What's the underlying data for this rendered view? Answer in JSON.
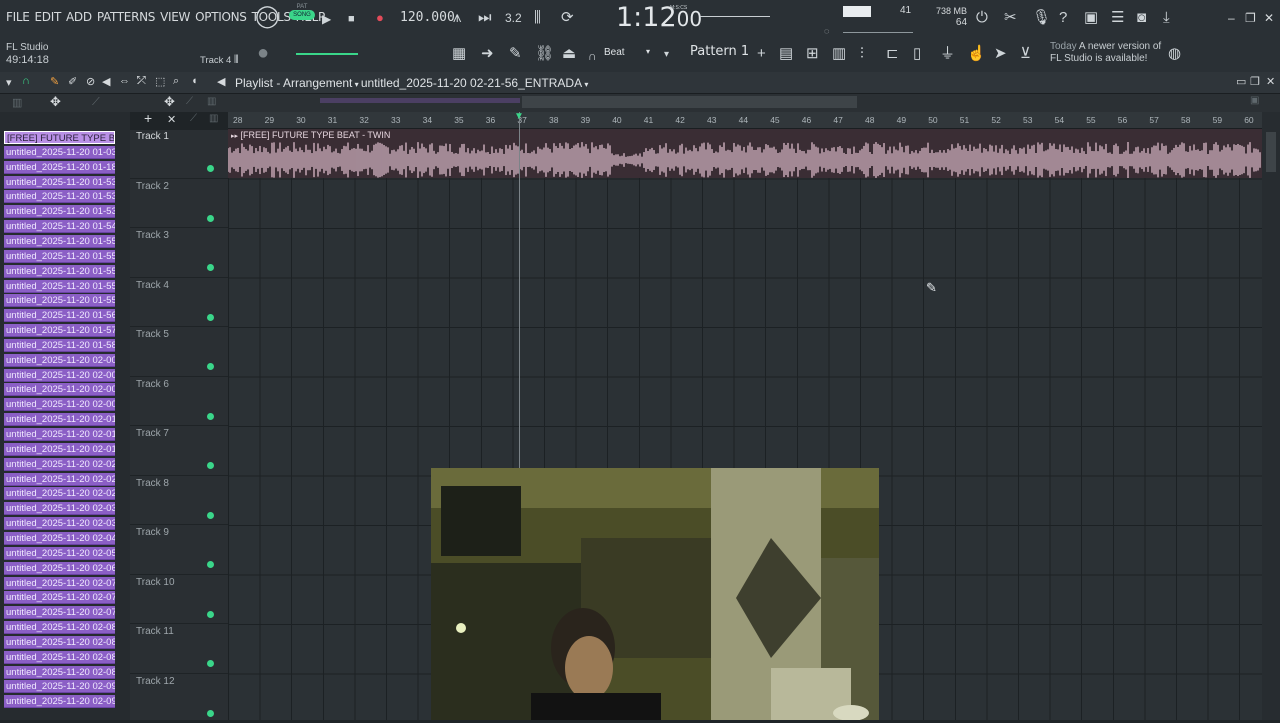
{
  "menu": [
    "FILE",
    "EDIT",
    "ADD",
    "PATTERNS",
    "VIEW",
    "OPTIONS",
    "TOOLS",
    "HELP"
  ],
  "transport": {
    "pat_label": "PAT",
    "song_label": "SONG",
    "tempo": "120.000",
    "time_main": "1:12",
    "time_sub": "00",
    "time_unit": "M:S:CS",
    "cpu": "41",
    "ram": "738 MB",
    "poly": "64"
  },
  "app": {
    "name": "FL Studio",
    "elapsed": "49:14:18",
    "track_hint": "Track 4"
  },
  "toolbar": {
    "snap": "Beat",
    "pattern": "Pattern 1",
    "pattern_add": "+"
  },
  "news": {
    "when": "Today",
    "line1": "A newer version of",
    "line2": "FL Studio is available!"
  },
  "playlist": {
    "title": "Playlist - Arrangement",
    "project": "untitled_2025-11-20 02-21-56_ENTRADA"
  },
  "ruler_labels": [
    "28",
    "29",
    "30",
    "31",
    "32",
    "33",
    "34",
    "35",
    "36",
    "37",
    "38",
    "39",
    "40",
    "41",
    "42",
    "43",
    "44",
    "45",
    "46",
    "47",
    "48",
    "49",
    "50",
    "51",
    "52",
    "53",
    "54",
    "55",
    "56",
    "57",
    "58",
    "59",
    "60"
  ],
  "clip": {
    "label": "[FREE] FUTURE TYPE BEAT - TWIN"
  },
  "tracks": [
    "Track 1",
    "Track 2",
    "Track 3",
    "Track 4",
    "Track 5",
    "Track 6",
    "Track 7",
    "Track 8",
    "Track 9",
    "Track 10",
    "Track 11",
    "Track 12"
  ],
  "patterns": [
    "[FREE] FUTURE TYPE BE...",
    "untitled_2025-11-20 01-03...",
    "untitled_2025-11-20 01-18...",
    "untitled_2025-11-20 01-53...",
    "untitled_2025-11-20 01-53...",
    "untitled_2025-11-20 01-53...",
    "untitled_2025-11-20 01-54...",
    "untitled_2025-11-20 01-55...",
    "untitled_2025-11-20 01-55...",
    "untitled_2025-11-20 01-55...",
    "untitled_2025-11-20 01-55...",
    "untitled_2025-11-20 01-55...",
    "untitled_2025-11-20 01-56...",
    "untitled_2025-11-20 01-57...",
    "untitled_2025-11-20 01-58...",
    "untitled_2025-11-20 02-00...",
    "untitled_2025-11-20 02-00...",
    "untitled_2025-11-20 02-00...",
    "untitled_2025-11-20 02-00...",
    "untitled_2025-11-20 02-01...",
    "untitled_2025-11-20 02-01...",
    "untitled_2025-11-20 02-01...",
    "untitled_2025-11-20 02-02...",
    "untitled_2025-11-20 02-02...",
    "untitled_2025-11-20 02-02...",
    "untitled_2025-11-20 02-03...",
    "untitled_2025-11-20 02-03...",
    "untitled_2025-11-20 02-04...",
    "untitled_2025-11-20 02-05...",
    "untitled_2025-11-20 02-06...",
    "untitled_2025-11-20 02-07...",
    "untitled_2025-11-20 02-07...",
    "untitled_2025-11-20 02-07...",
    "untitled_2025-11-20 02-08...",
    "untitled_2025-11-20 02-08...",
    "untitled_2025-11-20 02-08...",
    "untitled_2025-11-20 02-08...",
    "untitled_2025-11-20 02-09...",
    "untitled_2025-11-20 02-09..."
  ],
  "colors": {
    "clip_wave": "#e7c6d6",
    "pattern_bg": "#8b5fc6",
    "active_dot": "#3ad68a",
    "accent_green": "#3ad68a"
  }
}
